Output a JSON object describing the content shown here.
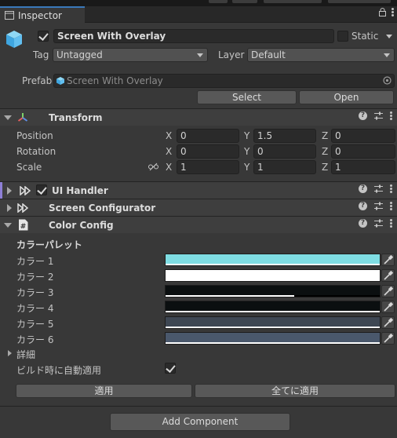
{
  "tab": {
    "title": "Inspector"
  },
  "header": {
    "object_name": "Screen With Overlay",
    "active": true,
    "static_label": "Static",
    "static": false,
    "tag_label": "Tag",
    "tag_value": "Untagged",
    "layer_label": "Layer",
    "layer_value": "Default",
    "prefab_label": "Prefab",
    "prefab_value": "Screen With Overlay",
    "select_label": "Select",
    "open_label": "Open"
  },
  "transform": {
    "title": "Transform",
    "rows": [
      {
        "label": "Position",
        "x": "0",
        "y": "1.5",
        "z": "0"
      },
      {
        "label": "Rotation",
        "x": "0",
        "y": "0",
        "z": "0"
      },
      {
        "label": "Scale",
        "x": "1",
        "y": "1",
        "z": "1"
      }
    ],
    "axis_x": "X",
    "axis_y": "Y",
    "axis_z": "Z"
  },
  "components": {
    "ui_handler": "UI Handler",
    "screen_configurator": "Screen Configurator",
    "color_config": "Color Config"
  },
  "color_config": {
    "section_title": "カラーパレット",
    "colors": [
      {
        "label": "カラー 1",
        "hex": "#7fdde3",
        "alpha": 1.0
      },
      {
        "label": "カラー 2",
        "hex": "#ffffff",
        "alpha": 1.0
      },
      {
        "label": "カラー 3",
        "hex": "#0b0f10",
        "alpha": 0.6
      },
      {
        "label": "カラー 4",
        "hex": "#0b0f10",
        "alpha": 1.0
      },
      {
        "label": "カラー 5",
        "hex": "#3e4753",
        "alpha": 1.0
      },
      {
        "label": "カラー 6",
        "hex": "#4a586c",
        "alpha": 1.0
      }
    ],
    "details_label": "詳細",
    "auto_apply_label": "ビルド時に自動適用",
    "auto_apply": true,
    "apply_label": "適用",
    "apply_all_label": "全てに適用"
  },
  "add_component_label": "Add Component",
  "colors": {
    "accent": "#3a79bb",
    "ui_handler_bar": "#8e7fd6"
  }
}
